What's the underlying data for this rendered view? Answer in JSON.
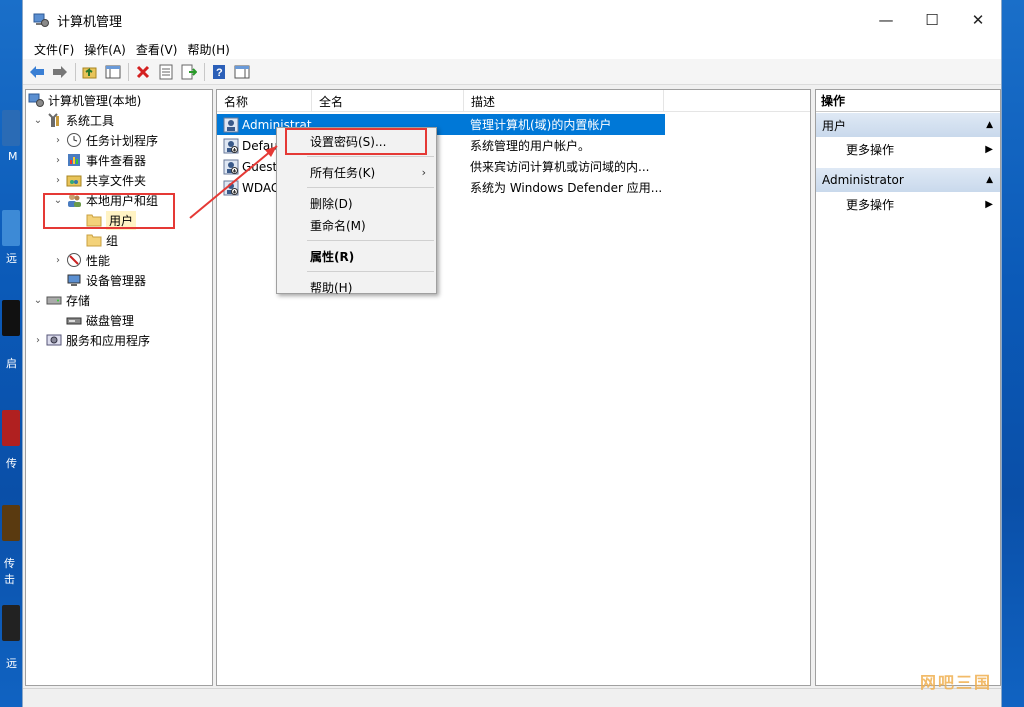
{
  "window": {
    "title": "计算机管理",
    "controls": {
      "minimize": "—",
      "maximize": "☐",
      "close": "✕"
    }
  },
  "menubar": [
    "文件(F)",
    "操作(A)",
    "查看(V)",
    "帮助(H)"
  ],
  "toolbar": {
    "icons": [
      "back-arrow-icon",
      "forward-arrow-icon",
      "up-folder-icon",
      "show-hide-tree-icon",
      "delete-icon",
      "properties-icon",
      "export-list-icon",
      "help-icon",
      "action-pane-icon"
    ]
  },
  "tree": {
    "root": "计算机管理(本地)",
    "system_tools": "系统工具",
    "task_scheduler": "任务计划程序",
    "event_viewer": "事件查看器",
    "shared_folders": "共享文件夹",
    "local_users_groups": "本地用户和组",
    "users": "用户",
    "groups": "组",
    "performance": "性能",
    "device_manager": "设备管理器",
    "storage": "存储",
    "disk_management": "磁盘管理",
    "services_apps": "服务和应用程序"
  },
  "list": {
    "columns": {
      "name": "名称",
      "fullname": "全名",
      "description": "描述"
    },
    "rows": [
      {
        "name": "Administrat",
        "fullname": "",
        "description": "管理计算机(域)的内置帐户"
      },
      {
        "name": "Defaul",
        "fullname": "",
        "description": "系统管理的用户帐户。"
      },
      {
        "name": "Guest",
        "fullname": "",
        "description": "供来宾访问计算机或访问域的内..."
      },
      {
        "name": "WDAG",
        "fullname": "",
        "description": "系统为 Windows Defender 应用..."
      }
    ]
  },
  "context_menu": {
    "set_password": "设置密码(S)...",
    "all_tasks": "所有任务(K)",
    "delete": "删除(D)",
    "rename": "重命名(M)",
    "properties": "属性(R)",
    "help": "帮助(H)"
  },
  "actions": {
    "title": "操作",
    "section1": "用户",
    "more1": "更多操作",
    "section2": "Administrator",
    "more2": "更多操作"
  },
  "desktop": {
    "labels": [
      "M",
      "远",
      "启",
      "传",
      "传击",
      "远"
    ]
  },
  "watermark": "网吧三国",
  "colors": {
    "selection": "#0078d7",
    "annotation": "#e53935",
    "action_section": "#c9d9ec"
  }
}
